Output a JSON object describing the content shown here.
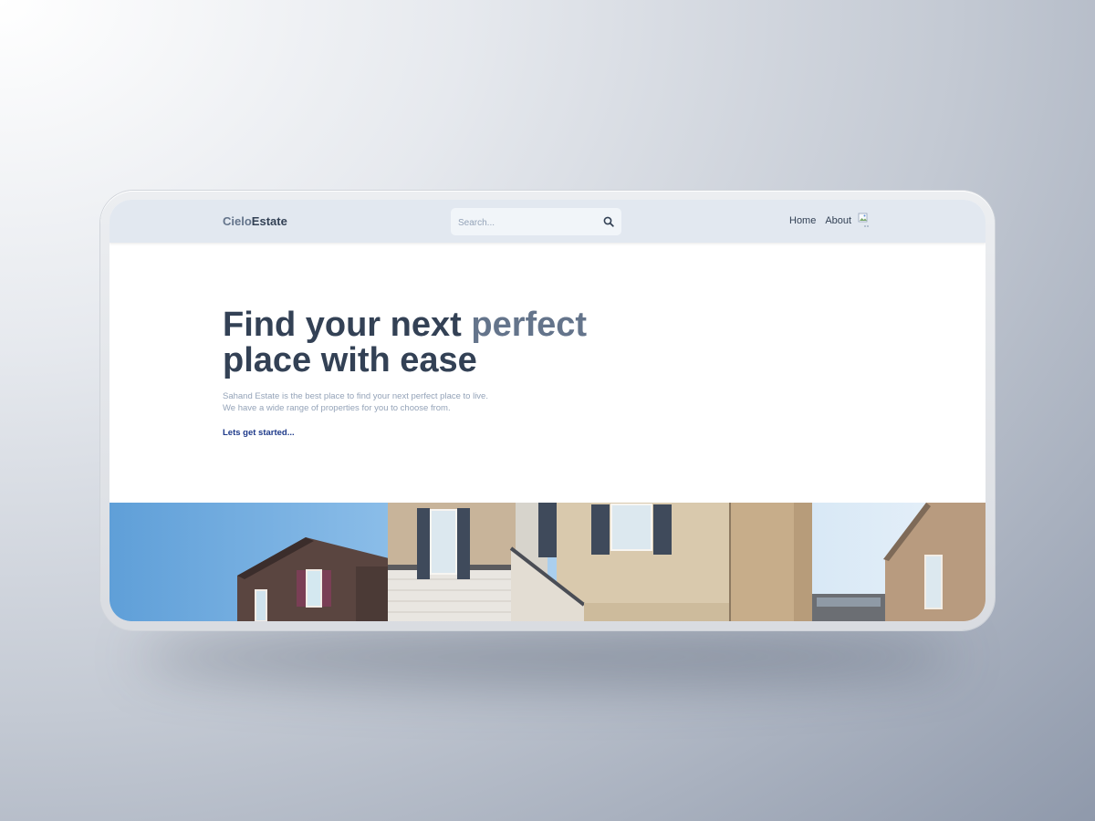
{
  "header": {
    "logo_part1": "Cielo",
    "logo_part2": "Estate",
    "search_placeholder": "Search...",
    "nav": [
      "Home",
      "About"
    ]
  },
  "hero": {
    "title_part1": "Find your next ",
    "title_accent": "perfect",
    "title_part2": "place with ease",
    "description_line1": "Sahand Estate is the best place to find your next perfect place to live.",
    "description_line2": "We have a wide range of properties for you to choose from.",
    "cta_label": "Lets get started..."
  },
  "icons": {
    "search": "search-icon",
    "avatar": "broken-image-icon"
  },
  "colors": {
    "header_bg": "#e2e8f0",
    "text_dark": "#334155",
    "text_muted": "#64748b",
    "cta": "#1e3a8a"
  }
}
